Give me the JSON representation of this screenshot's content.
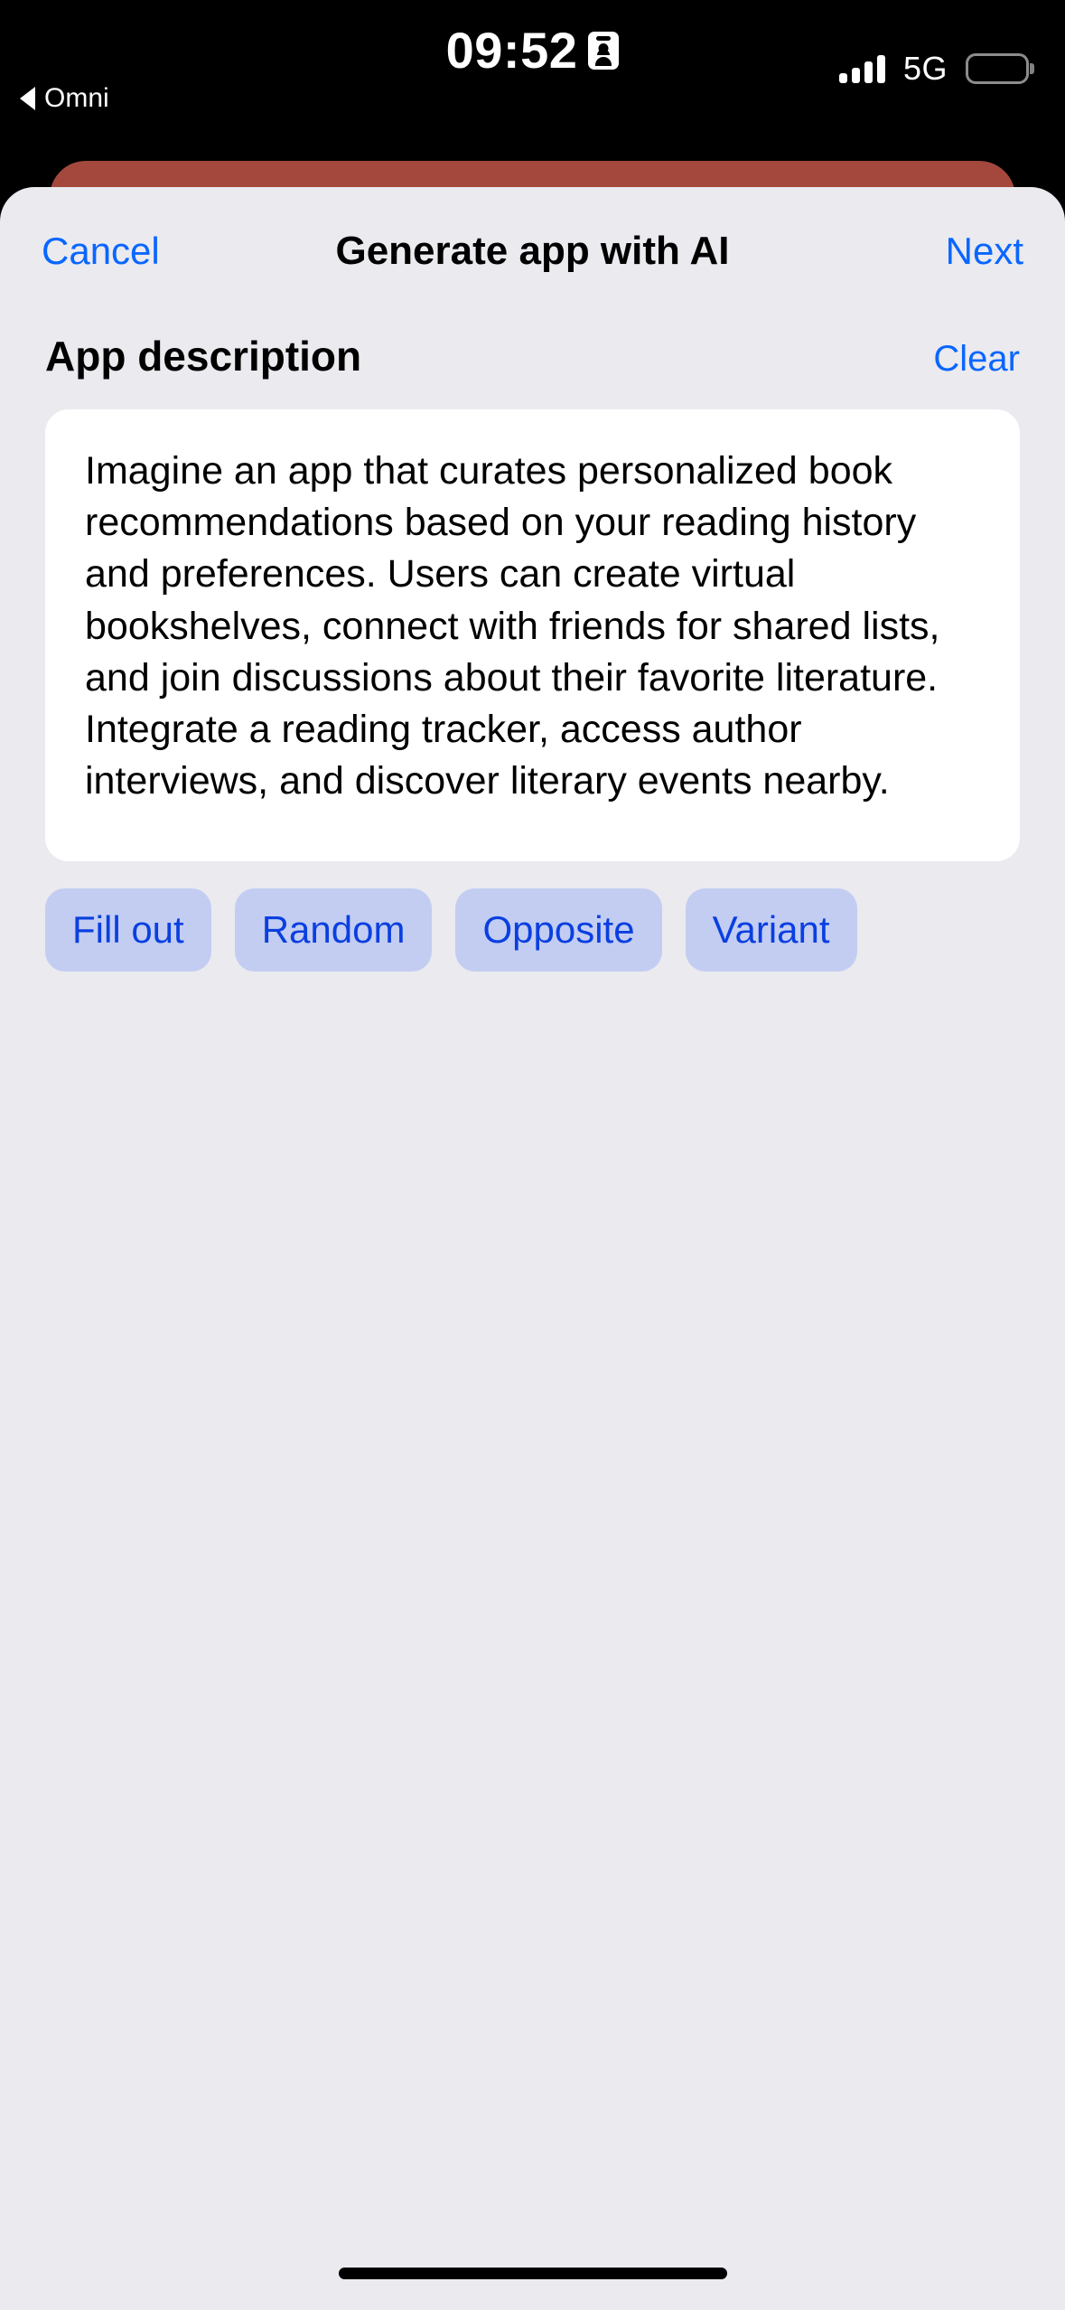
{
  "status_bar": {
    "time": "09:52",
    "badge_icon": "person-badge-icon",
    "back_label": "Omni",
    "back_icon": "back-triangle-icon",
    "cellular_icon": "signal-bars-icon",
    "network": "5G",
    "battery_icon": "battery-icon"
  },
  "nav": {
    "cancel_label": "Cancel",
    "title": "Generate app with AI",
    "next_label": "Next"
  },
  "section": {
    "title": "App description",
    "clear_label": "Clear"
  },
  "description": {
    "value": "Imagine an app that curates personalized book recommendations based on your reading history and preferences. Users can create virtual bookshelves, connect with friends for shared lists, and join discussions about their favorite literature. Integrate a reading tracker, access author interviews, and discover literary events nearby.",
    "placeholder": "App description"
  },
  "chips": [
    {
      "label": "Fill out"
    },
    {
      "label": "Random"
    },
    {
      "label": "Opposite"
    },
    {
      "label": "Variant"
    }
  ],
  "colors": {
    "accent_blue": "#0a66ff",
    "chip_bg": "#c3cdf2",
    "chip_text": "#0a3fe0",
    "sheet_bg": "#eaeaef",
    "card_bg": "#ffffff",
    "behind_card": "#a4483d"
  }
}
